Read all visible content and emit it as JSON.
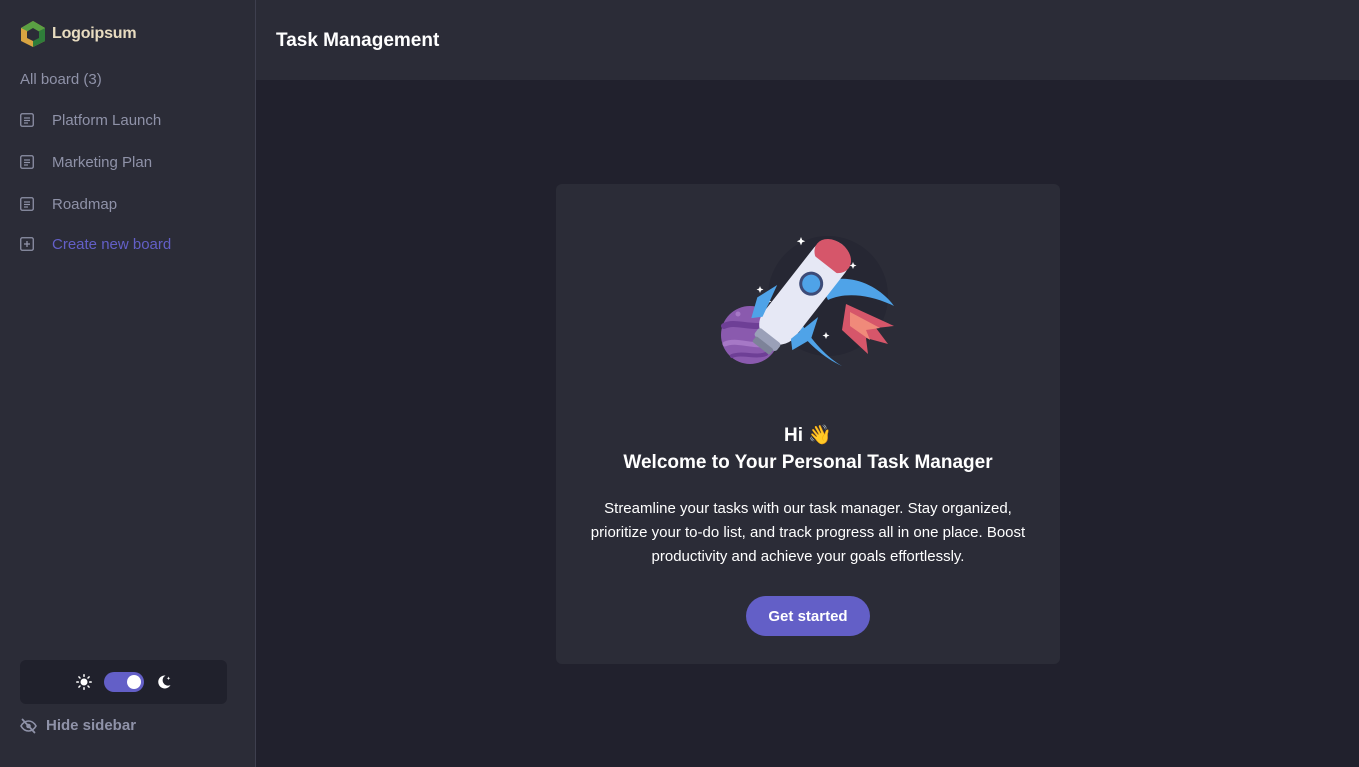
{
  "brand": {
    "name": "Logoipsum"
  },
  "sidebar": {
    "board_count_label": "All board (3)",
    "boards": [
      {
        "label": "Platform Launch",
        "icon": "board-icon"
      },
      {
        "label": "Marketing Plan",
        "icon": "board-icon"
      },
      {
        "label": "Roadmap",
        "icon": "board-icon"
      }
    ],
    "create_label": "Create new board",
    "hide_label": "Hide sidebar",
    "theme": {
      "mode": "dark",
      "light_icon": "sun-icon",
      "dark_icon": "moon-icon"
    }
  },
  "header": {
    "title": "Task Management"
  },
  "welcome": {
    "greeting": "Hi 👋",
    "title": "Welcome to Your Personal Task Manager",
    "description": "Streamline your tasks with our task manager. Stay organized, prioritize your to-do list, and track progress all in one place. Boost productivity and achieve your goals effortlessly.",
    "cta_label": "Get started"
  },
  "colors": {
    "accent": "#635fc7",
    "sidebar_bg": "#2b2c37",
    "main_bg": "#21212d",
    "muted_text": "#8f92a8"
  }
}
